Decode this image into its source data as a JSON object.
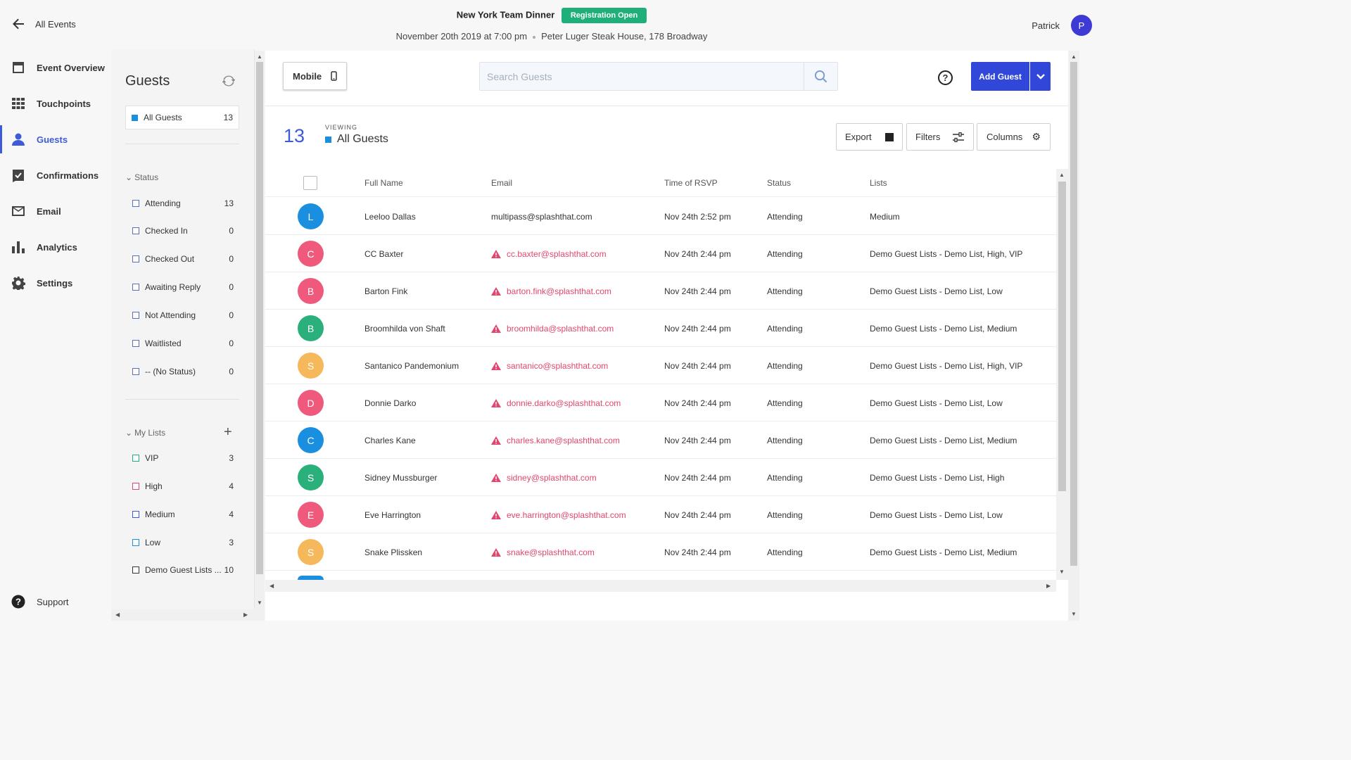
{
  "header": {
    "back_label": "All Events",
    "event_title": "New York Team Dinner",
    "badge": "Registration Open",
    "date": "November 20th 2019 at 7:00 pm",
    "location": "Peter Luger Steak House, 178 Broadway",
    "user_name": "Patrick",
    "user_initial": "P"
  },
  "nav": {
    "items": [
      {
        "label": "Event Overview",
        "icon": "calendar-icon"
      },
      {
        "label": "Touchpoints",
        "icon": "grid-icon"
      },
      {
        "label": "Guests",
        "icon": "person-icon",
        "active": true
      },
      {
        "label": "Confirmations",
        "icon": "check-calendar-icon"
      },
      {
        "label": "Email",
        "icon": "envelope-icon"
      },
      {
        "label": "Analytics",
        "icon": "bar-chart-icon"
      },
      {
        "label": "Settings",
        "icon": "gear-icon"
      }
    ],
    "support": "Support"
  },
  "filters": {
    "title": "Guests",
    "all_guests": {
      "label": "All Guests",
      "count": "13"
    },
    "status_header": "Status",
    "status": [
      {
        "label": "Attending",
        "count": "13"
      },
      {
        "label": "Checked In",
        "count": "0"
      },
      {
        "label": "Checked Out",
        "count": "0"
      },
      {
        "label": "Awaiting Reply",
        "count": "0"
      },
      {
        "label": "Not Attending",
        "count": "0"
      },
      {
        "label": "Waitlisted",
        "count": "0"
      },
      {
        "label": "-- (No Status)",
        "count": "0"
      }
    ],
    "lists_header": "My Lists",
    "lists": [
      {
        "label": "VIP",
        "count": "3",
        "color": "#1fb07a"
      },
      {
        "label": "High",
        "count": "4",
        "color": "#e0466e"
      },
      {
        "label": "Medium",
        "count": "4",
        "color": "#3d5bd9"
      },
      {
        "label": "Low",
        "count": "3",
        "color": "#1a8fe0"
      },
      {
        "label": "Demo Guest Lists ...",
        "count": "10",
        "color": "#333333"
      }
    ]
  },
  "toolbar": {
    "mobile_label": "Mobile",
    "search_placeholder": "Search Guests",
    "help_label": "?",
    "add_guest_label": "Add Guest"
  },
  "viewing": {
    "count": "13",
    "label": "VIEWING",
    "value": "All Guests",
    "export_label": "Export",
    "filters_label": "Filters",
    "columns_label": "Columns"
  },
  "table": {
    "headers": [
      "Full Name",
      "Email",
      "Time of RSVP",
      "Status",
      "Lists"
    ],
    "rows": [
      {
        "initial": "L",
        "color": "#1a8fe0",
        "name": "Leeloo Dallas",
        "email": "multipass@splashthat.com",
        "warn": false,
        "time": "Nov 24th 2:52 pm",
        "status": "Attending",
        "lists": "Medium"
      },
      {
        "initial": "C",
        "color": "#ef5a7c",
        "name": "CC Baxter",
        "email": "cc.baxter@splashthat.com",
        "warn": true,
        "time": "Nov 24th 2:44 pm",
        "status": "Attending",
        "lists": "Demo Guest Lists - Demo List, High, VIP"
      },
      {
        "initial": "B",
        "color": "#ef5a7c",
        "name": "Barton Fink",
        "email": "barton.fink@splashthat.com",
        "warn": true,
        "time": "Nov 24th 2:44 pm",
        "status": "Attending",
        "lists": "Demo Guest Lists - Demo List, Low"
      },
      {
        "initial": "B",
        "color": "#2bb07c",
        "name": "Broomhilda von Shaft",
        "email": "broomhilda@splashthat.com",
        "warn": true,
        "time": "Nov 24th 2:44 pm",
        "status": "Attending",
        "lists": "Demo Guest Lists - Demo List, Medium"
      },
      {
        "initial": "S",
        "color": "#f5b85a",
        "name": "Santanico Pandemonium",
        "email": "santanico@splashthat.com",
        "warn": true,
        "time": "Nov 24th 2:44 pm",
        "status": "Attending",
        "lists": "Demo Guest Lists - Demo List, High, VIP"
      },
      {
        "initial": "D",
        "color": "#ef5a7c",
        "name": "Donnie Darko",
        "email": "donnie.darko@splashthat.com",
        "warn": true,
        "time": "Nov 24th 2:44 pm",
        "status": "Attending",
        "lists": "Demo Guest Lists - Demo List, Low"
      },
      {
        "initial": "C",
        "color": "#1a8fe0",
        "name": "Charles Kane",
        "email": "charles.kane@splashthat.com",
        "warn": true,
        "time": "Nov 24th 2:44 pm",
        "status": "Attending",
        "lists": "Demo Guest Lists - Demo List, Medium"
      },
      {
        "initial": "S",
        "color": "#2bb07c",
        "name": "Sidney Mussburger",
        "email": "sidney@splashthat.com",
        "warn": true,
        "time": "Nov 24th 2:44 pm",
        "status": "Attending",
        "lists": "Demo Guest Lists - Demo List, High"
      },
      {
        "initial": "E",
        "color": "#ef5a7c",
        "name": "Eve Harrington",
        "email": "eve.harrington@splashthat.com",
        "warn": true,
        "time": "Nov 24th 2:44 pm",
        "status": "Attending",
        "lists": "Demo Guest Lists - Demo List, Low"
      },
      {
        "initial": "S",
        "color": "#f5b85a",
        "name": "Snake Plissken",
        "email": "snake@splashthat.com",
        "warn": true,
        "time": "Nov 24th 2:44 pm",
        "status": "Attending",
        "lists": "Demo Guest Lists - Demo List, Medium"
      }
    ]
  }
}
